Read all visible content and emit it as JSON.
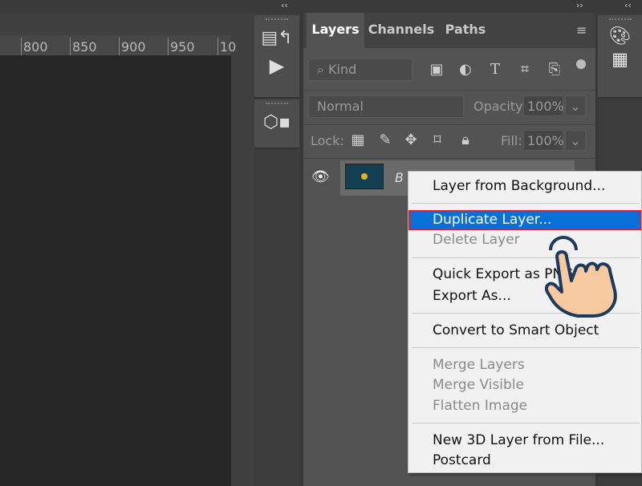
{
  "ruler": {
    "ticks": [
      "800",
      "850",
      "900",
      "950",
      "10"
    ]
  },
  "panel": {
    "tabs": [
      "Layers",
      "Channels",
      "Paths"
    ],
    "filter": {
      "placeholder": "Kind"
    },
    "blend_mode": "Normal",
    "opacity_label": "Opacity:",
    "opacity": "100%",
    "lock_label": "Lock:",
    "fill_label": "Fill:",
    "fill": "100%",
    "layer": {
      "name": "B"
    }
  },
  "context_menu": {
    "items": [
      {
        "label": "Layer from Background...",
        "state": "enabled"
      },
      {
        "label": "Duplicate Layer...",
        "state": "highlighted"
      },
      {
        "label": "Delete Layer",
        "state": "disabled"
      },
      {
        "label": "Quick Export as PNG",
        "state": "enabled"
      },
      {
        "label": "Export As...",
        "state": "enabled"
      },
      {
        "label": "Convert to Smart Object",
        "state": "enabled"
      },
      {
        "label": "Merge Layers",
        "state": "disabled"
      },
      {
        "label": "Merge Visible",
        "state": "disabled"
      },
      {
        "label": "Flatten Image",
        "state": "disabled"
      },
      {
        "label": "New 3D Layer from File...",
        "state": "enabled"
      },
      {
        "label": "Postcard",
        "state": "enabled"
      }
    ]
  },
  "colors": {
    "highlight": "#0a6fd6",
    "highlight_border": "#e0202a"
  },
  "icons": [
    "history-icon",
    "play-icon",
    "3d-icon",
    "palette-icon",
    "swatches-icon",
    "pointing-hand-icon"
  ]
}
